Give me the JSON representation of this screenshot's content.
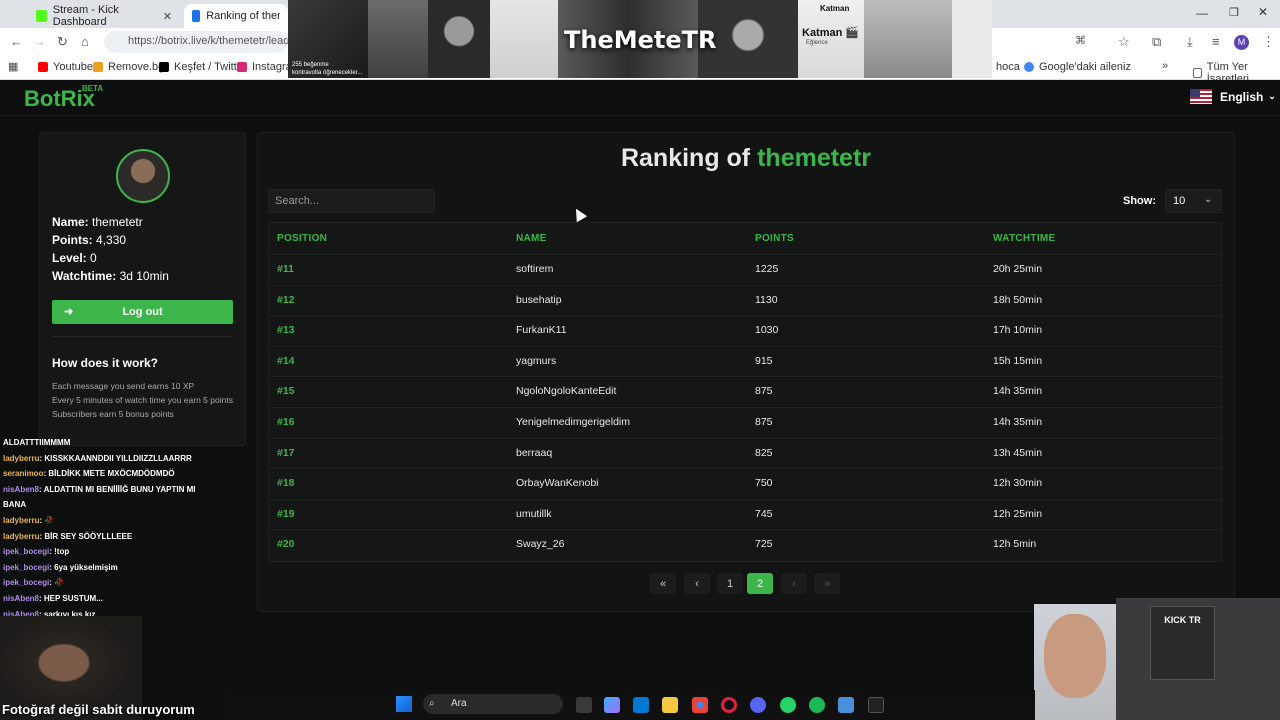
{
  "browser": {
    "tabs": [
      {
        "title": "Stream - Kick Dashboard",
        "favicon_color": "#53fc18"
      },
      {
        "title": "Ranking of themetetr |",
        "favicon_color": "#1a73e8"
      }
    ],
    "url": "https://botrix.live/k/themetetr/leaderb",
    "bookmarks": [
      {
        "label": "Youtube",
        "color": "#ff0000"
      },
      {
        "label": "Remove.bg",
        "color": "#f0a020"
      },
      {
        "label": "Keşfet / Twitter",
        "color": "#000000"
      },
      {
        "label": "Instagram",
        "color": "#d62976"
      },
      {
        "label": "hoca",
        "color": "#888888"
      },
      {
        "label": "Google'daki aileniz",
        "color": "#4285f4"
      },
      {
        "label": "Tüm Yer İşaretleri",
        "color": "#666666"
      }
    ],
    "profile_initial": "M"
  },
  "banner": {
    "title": "TheMeteTR",
    "caption": "255 beğenme",
    "caption2": "kontravolta öğrenecekler...",
    "katman": "Katman",
    "katman2": "Katman 🎬",
    "eglence": "Eğlence"
  },
  "site": {
    "logo": "BotRix",
    "logo_badge": "BETA",
    "language": "English"
  },
  "profile": {
    "name_label": "Name:",
    "name": "themetetr",
    "points_label": "Points:",
    "points": "4,330",
    "level_label": "Level:",
    "level": "0",
    "watchtime_label": "Watchtime:",
    "watchtime": "3d 10min",
    "logout": "Log out",
    "how_title": "How does it work?",
    "how_notes": [
      "Each message you send earns 10 XP",
      "Every 5 minutes of watch time you earn 5 points",
      "Subscribers earn 5 bonus points"
    ]
  },
  "ranking": {
    "title_prefix": "Ranking of",
    "title_user": "themetetr",
    "search_placeholder": "Search...",
    "show_label": "Show:",
    "show_value": "10",
    "columns": [
      "POSITION",
      "NAME",
      "POINTS",
      "WATCHTIME"
    ],
    "rows": [
      {
        "position": "#11",
        "name": "softirem",
        "points": "1225",
        "watchtime": "20h 25min"
      },
      {
        "position": "#12",
        "name": "busehatip",
        "points": "1130",
        "watchtime": "18h 50min"
      },
      {
        "position": "#13",
        "name": "FurkanK11",
        "points": "1030",
        "watchtime": "17h 10min"
      },
      {
        "position": "#14",
        "name": "yagmurs",
        "points": "915",
        "watchtime": "15h 15min"
      },
      {
        "position": "#15",
        "name": "NgoloNgoloKanteEdit",
        "points": "875",
        "watchtime": "14h 35min"
      },
      {
        "position": "#16",
        "name": "Yenigelmedimgerigeldim",
        "points": "875",
        "watchtime": "14h 35min"
      },
      {
        "position": "#17",
        "name": "berraaq",
        "points": "825",
        "watchtime": "13h 45min"
      },
      {
        "position": "#18",
        "name": "OrbayWanKenobi",
        "points": "750",
        "watchtime": "12h 30min"
      },
      {
        "position": "#19",
        "name": "umutillk",
        "points": "745",
        "watchtime": "12h 25min"
      },
      {
        "position": "#20",
        "name": "Swayz_26",
        "points": "725",
        "watchtime": "12h 5min"
      }
    ],
    "pagination": {
      "first": "«",
      "prev": "‹",
      "pages": [
        "1",
        "2"
      ],
      "current": "2",
      "next": "›",
      "last": "»"
    }
  },
  "chat": [
    {
      "user": "",
      "text": "ALDATTTIIMMMM",
      "color": "g"
    },
    {
      "user": "ladyberru",
      "text": ": KISSKKAANNDDII YILLDIIZZLLAARRR",
      "color": "y"
    },
    {
      "user": "seranimoo",
      "text": ": BİLDİKK METE MXÖCMDÖDMDÖ",
      "color": "y"
    },
    {
      "user": "nisAben8",
      "text": ": ALDATTIN MI BENİİİİĞ BUNU YAPTIN MI",
      "color": "p"
    },
    {
      "user": "",
      "text": "BANA",
      "color": "g"
    },
    {
      "user": "ladyberru",
      "text": ": 🥀",
      "color": "y"
    },
    {
      "user": "ladyberru",
      "text": ": BİR SEY SÖÖYLLLEEE",
      "color": "y"
    },
    {
      "user": "ipek_bocegi",
      "text": ": !top",
      "color": "p"
    },
    {
      "user": "ipek_bocegi",
      "text": ": 6ya yükselmişim",
      "color": "p"
    },
    {
      "user": "ipek_bocegi",
      "text": ": 🥀",
      "color": "p"
    },
    {
      "user": "nisAben8",
      "text": ": HEP SUSTUM...",
      "color": "p"
    },
    {
      "user": "nisAben8",
      "text": ": şarkıyı kıs kız",
      "color": "p"
    }
  ],
  "webcam_caption": "Fotoğraf değil sabit duruyorum",
  "kick_sign": "KICK TR",
  "taskbar": {
    "search": "Ara"
  }
}
